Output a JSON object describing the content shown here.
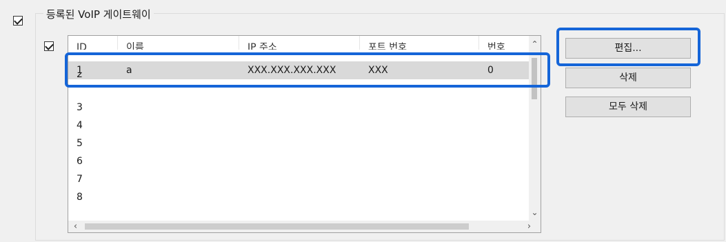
{
  "group": {
    "title": "등록된 VoIP 게이트웨이",
    "enabled": true,
    "list_check": true
  },
  "table": {
    "columns": [
      "ID",
      "이름",
      "IP 주소",
      "포트 번호",
      "번호"
    ],
    "rows": [
      {
        "id": "1",
        "name": "a",
        "ip": "XXX.XXX.XXX.XXX",
        "port": "XXX",
        "number": "0"
      },
      {
        "id": "2",
        "name": "",
        "ip": "",
        "port": "",
        "number": ""
      },
      {
        "id": "3",
        "name": "",
        "ip": "",
        "port": "",
        "number": ""
      },
      {
        "id": "4",
        "name": "",
        "ip": "",
        "port": "",
        "number": ""
      },
      {
        "id": "5",
        "name": "",
        "ip": "",
        "port": "",
        "number": ""
      },
      {
        "id": "6",
        "name": "",
        "ip": "",
        "port": "",
        "number": ""
      },
      {
        "id": "7",
        "name": "",
        "ip": "",
        "port": "",
        "number": ""
      },
      {
        "id": "8",
        "name": "",
        "ip": "",
        "port": "",
        "number": ""
      }
    ],
    "selected_row": 0
  },
  "buttons": {
    "edit": "편집...",
    "delete": "삭제",
    "delete_all": "모두 삭제"
  },
  "icons": {
    "scroll_up": "scroll-up-icon",
    "scroll_down": "scroll-down-icon",
    "scroll_left": "scroll-left-icon",
    "scroll_right": "scroll-right-icon"
  },
  "colors": {
    "highlight": "#1565d8",
    "selection": "#d9d9d9"
  }
}
